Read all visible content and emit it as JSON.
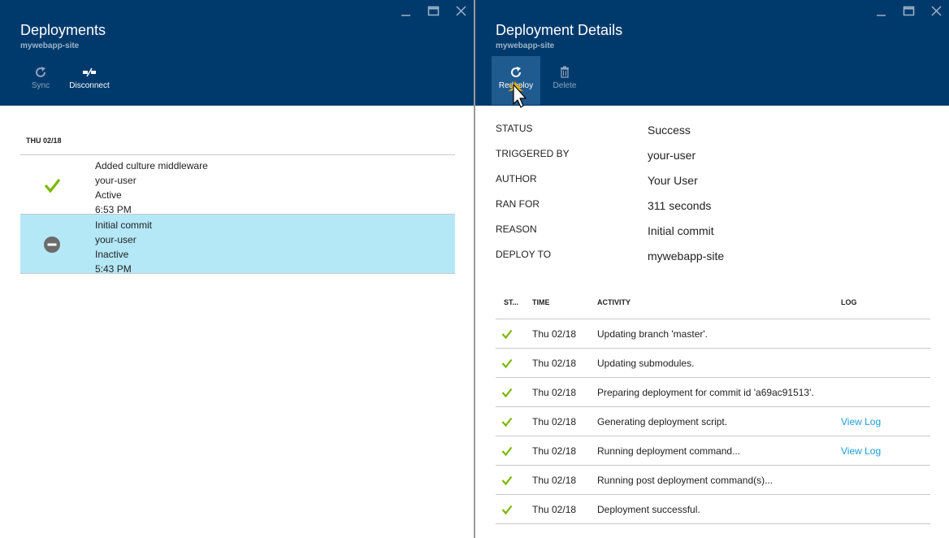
{
  "colors": {
    "header_bg": "#003a6c",
    "selected_row": "#b4e8f7",
    "success_green": "#7ab800",
    "link_blue": "#1a9fd5"
  },
  "left_blade": {
    "title": "Deployments",
    "subtitle": "mywebapp-site",
    "commands": [
      {
        "label": "Sync",
        "icon": "sync-icon",
        "enabled": false
      },
      {
        "label": "Disconnect",
        "icon": "disconnect-icon",
        "enabled": true
      }
    ],
    "date_header": "THU 02/18",
    "deployments": [
      {
        "status_icon": "checkmark-icon",
        "message": "Added culture middleware",
        "author": "your-user",
        "state": "Active",
        "time": "6:53 PM",
        "selected": false
      },
      {
        "status_icon": "minus-circle-icon",
        "message": "Initial commit",
        "author": "your-user",
        "state": "Inactive",
        "time": "5:43 PM",
        "selected": true
      }
    ]
  },
  "right_blade": {
    "title": "Deployment Details",
    "subtitle": "mywebapp-site",
    "commands": [
      {
        "label": "Redeploy",
        "icon": "redeploy-icon",
        "enabled": true,
        "active": true
      },
      {
        "label": "Delete",
        "icon": "trash-icon",
        "enabled": false
      }
    ],
    "properties": [
      {
        "label": "STATUS",
        "value": "Success"
      },
      {
        "label": "TRIGGERED BY",
        "value": "your-user"
      },
      {
        "label": "AUTHOR",
        "value": "Your User"
      },
      {
        "label": "RAN FOR",
        "value": "311 seconds"
      },
      {
        "label": "REASON",
        "value": "Initial commit"
      },
      {
        "label": "DEPLOY TO",
        "value": "mywebapp-site"
      }
    ],
    "log_table": {
      "columns": [
        "ST...",
        "TIME",
        "ACTIVITY",
        "LOG"
      ],
      "rows": [
        {
          "status": "success",
          "time": "Thu 02/18",
          "activity": "Updating branch 'master'.",
          "log": ""
        },
        {
          "status": "success",
          "time": "Thu 02/18",
          "activity": "Updating submodules.",
          "log": ""
        },
        {
          "status": "success",
          "time": "Thu 02/18",
          "activity": "Preparing deployment for commit id 'a69ac91513'.",
          "log": ""
        },
        {
          "status": "success",
          "time": "Thu 02/18",
          "activity": "Generating deployment script.",
          "log": "View Log"
        },
        {
          "status": "success",
          "time": "Thu 02/18",
          "activity": "Running deployment command...",
          "log": "View Log"
        },
        {
          "status": "success",
          "time": "Thu 02/18",
          "activity": "Running post deployment command(s)...",
          "log": ""
        },
        {
          "status": "success",
          "time": "Thu 02/18",
          "activity": "Deployment successful.",
          "log": ""
        }
      ]
    }
  }
}
